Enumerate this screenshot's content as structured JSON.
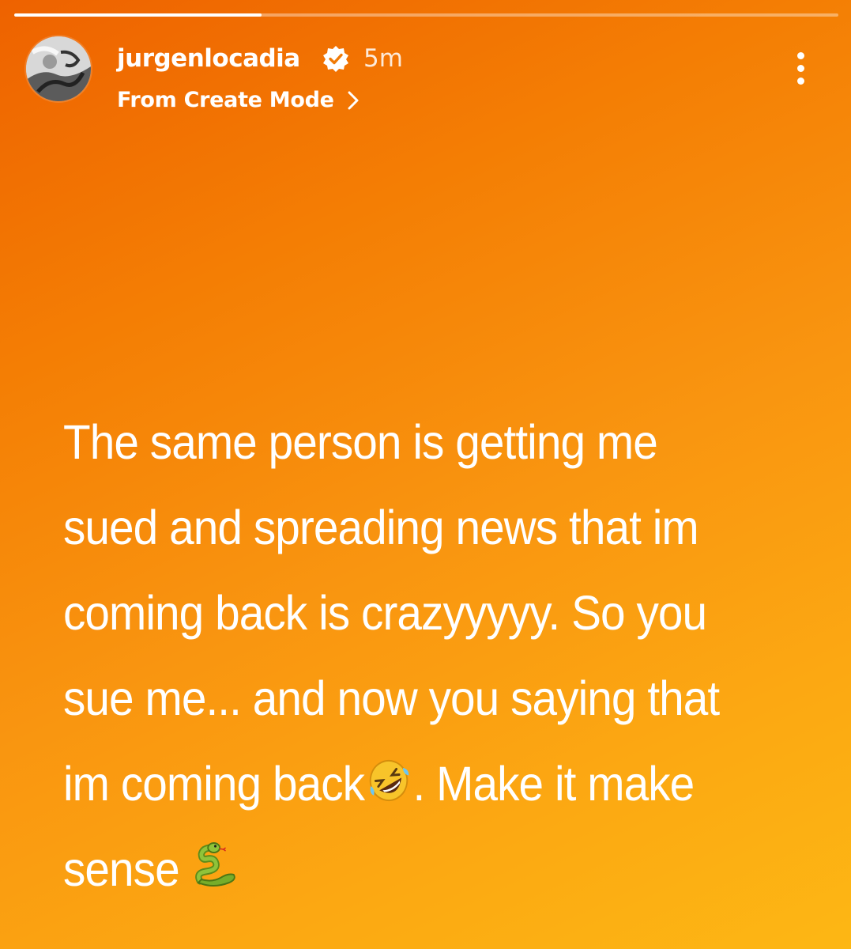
{
  "progress": {
    "fraction": 0.3
  },
  "header": {
    "avatar_icon": "profile-photo",
    "username": "jurgenlocadia",
    "verified_icon": "verified-badge-icon",
    "time": "5m",
    "source_label": "From Create Mode",
    "source_chevron_icon": "chevron-right-icon",
    "menu_icon": "more-options-icon"
  },
  "story": {
    "text_parts": [
      "The same person is getting me sued and spreading news that im coming back is crazyyyyy. So you sue me... and now you saying that im coming back",
      ". Make it make sense"
    ],
    "emojis": [
      "rolling-on-floor-laughing-emoji",
      "snake-emoji"
    ]
  },
  "colors": {
    "background_top": "#ee6200",
    "background_bottom": "#fdb714",
    "text": "#ffffff"
  }
}
